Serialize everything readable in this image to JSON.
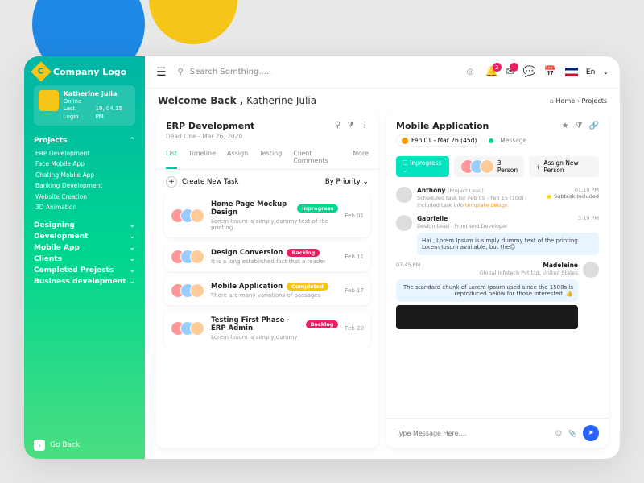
{
  "company": "Company Logo",
  "user": {
    "name": "Katherine Julia",
    "status": "Online",
    "lastLogin": "Last Login",
    "lastTime": "19, 04.15 PM"
  },
  "nav": {
    "projects": {
      "label": "Projects",
      "items": [
        "ERP Development",
        "Face Mobile App",
        "Chating Mobile App",
        "Banking Development",
        "Website Creation",
        "3D Animation"
      ]
    },
    "sections": [
      "Designing",
      "Development",
      "Mobile App",
      "Clients",
      "Completed Projects",
      "Business development"
    ]
  },
  "goBack": "Go Back",
  "search": {
    "placeholder": "Search Somthing....."
  },
  "notifBadge": "2",
  "lang": "En",
  "welcome": {
    "pre": "Welcome Back ,",
    "name": "Katherine Julia"
  },
  "breadcrumb": {
    "home": "Home",
    "current": "Projects"
  },
  "erp": {
    "title": "ERP Development",
    "deadline": "Dead Line - Mar 26, 2020",
    "tabs": [
      "List",
      "Timeline",
      "Assign",
      "Testing",
      "Client Comments",
      "More"
    ],
    "create": "Create New Task",
    "sort": "By Priority",
    "tasks": [
      {
        "title": "Home Page Mockup Design",
        "status": "Inprogress",
        "statusClass": "pill-green",
        "desc": "Lorem Ipsum is simply dummy text of the printing",
        "date": "Feb 01"
      },
      {
        "title": "Design Conversion",
        "status": "Backlog",
        "statusClass": "pill-red",
        "desc": "It is a long established fact that a reader",
        "date": "Feb 11"
      },
      {
        "title": "Mobile Application",
        "status": "Completed",
        "statusClass": "pill-yellow",
        "desc": "There are many variations of passages",
        "date": "Feb 17"
      },
      {
        "title": "Testing First Phase - ERP Admin",
        "status": "Backlog",
        "statusClass": "pill-red",
        "desc": "Lorem Ipsum is simply dummy",
        "date": "Feb 20"
      }
    ]
  },
  "mobile": {
    "title": "Mobile Application",
    "dates": "Feb 01 - Mar 26 (45d)",
    "msgLabel": "Message",
    "status": "Inprogress",
    "persons": "3 Person",
    "assign": "Assign New Person",
    "chat": [
      {
        "name": "Anthony",
        "role": "(Project Lead)",
        "meta": "Scheduled task for Feb 05 - Feb 15 (10d)",
        "extra": "Included task info",
        "link": "template design",
        "time": "01.19 PM",
        "subtask": "Subtask Included"
      },
      {
        "name": "Gabrielle",
        "role": "",
        "meta": "Design Lead - Front end Developer",
        "bubble": "Hai , Lorem Ipsum is simply dummy text of the printing. Lorem Ipsum available, but the😊",
        "time": "3.19 PM"
      },
      {
        "name": "Madeleine",
        "role": "",
        "meta": "Global Infotech Pvt Ltd, United States",
        "bubble": "The standard chunk of Lorem Ipsum used since the 1500s is reproduced below for those interested. 👍",
        "time": "07.45 PM",
        "right": true,
        "img": true
      }
    ],
    "inputPlaceholder": "Type Message Here...."
  }
}
